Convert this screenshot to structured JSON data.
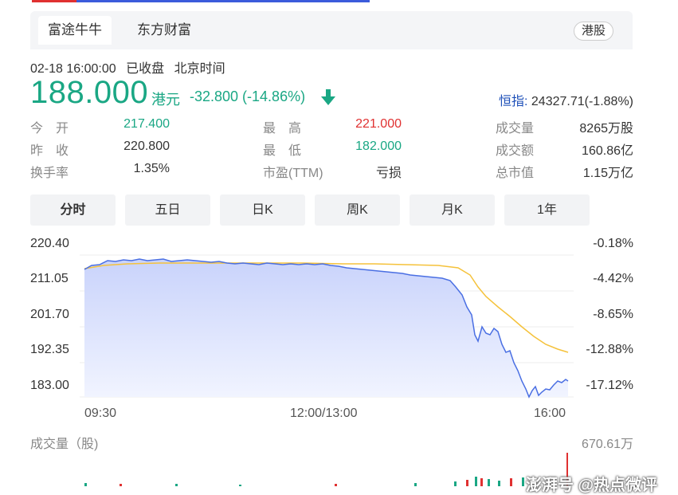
{
  "tabs": [
    {
      "label": "富途牛牛",
      "active": true
    },
    {
      "label": "东方财富",
      "active": false
    }
  ],
  "market_badge": "港股",
  "quote": {
    "date_time": "02-18 16:00:00",
    "status": "已收盘",
    "timezone": "北京时间",
    "price": "188.000",
    "currency": "港元",
    "change": "-32.800 (-14.86%)",
    "index_label": "恒指:",
    "index_value": "24327.71(-1.88%)"
  },
  "stats": {
    "open_label": "今　开",
    "open": "217.400",
    "prev_close_label": "昨　收",
    "prev_close": "220.800",
    "turnover_rate_label": "换手率",
    "turnover_rate": "1.35%",
    "high_label": "最　高",
    "high": "221.000",
    "low_label": "最　低",
    "low": "182.000",
    "pe_label": "市盈(TTM)",
    "pe": "亏损",
    "volume_label": "成交量",
    "volume": "8265万股",
    "amount_label": "成交额",
    "amount": "160.86亿",
    "market_cap_label": "总市值",
    "market_cap": "1.15万亿"
  },
  "periods": [
    {
      "label": "分时",
      "active": true
    },
    {
      "label": "五日",
      "active": false
    },
    {
      "label": "日K",
      "active": false
    },
    {
      "label": "周K",
      "active": false
    },
    {
      "label": "月K",
      "active": false
    },
    {
      "label": "1年",
      "active": false
    }
  ],
  "chart": {
    "y_left": [
      "220.40",
      "211.05",
      "201.70",
      "192.35",
      "183.00"
    ],
    "y_right": [
      "-0.18%",
      "-4.42%",
      "-8.65%",
      "-12.88%",
      "-17.12%"
    ],
    "x_labels": [
      "09:30",
      "12:00/13:00",
      "16:00"
    ],
    "volume_title": "成交量（股)",
    "volume_max": "670.61万"
  },
  "colors": {
    "down": "#1aa784",
    "up": "#e03131",
    "price_line": "#4a6fe3",
    "avg_line": "#f5c23b",
    "index_link": "#1d4fb8"
  },
  "watermark": "澎湃号 @热点微评"
}
